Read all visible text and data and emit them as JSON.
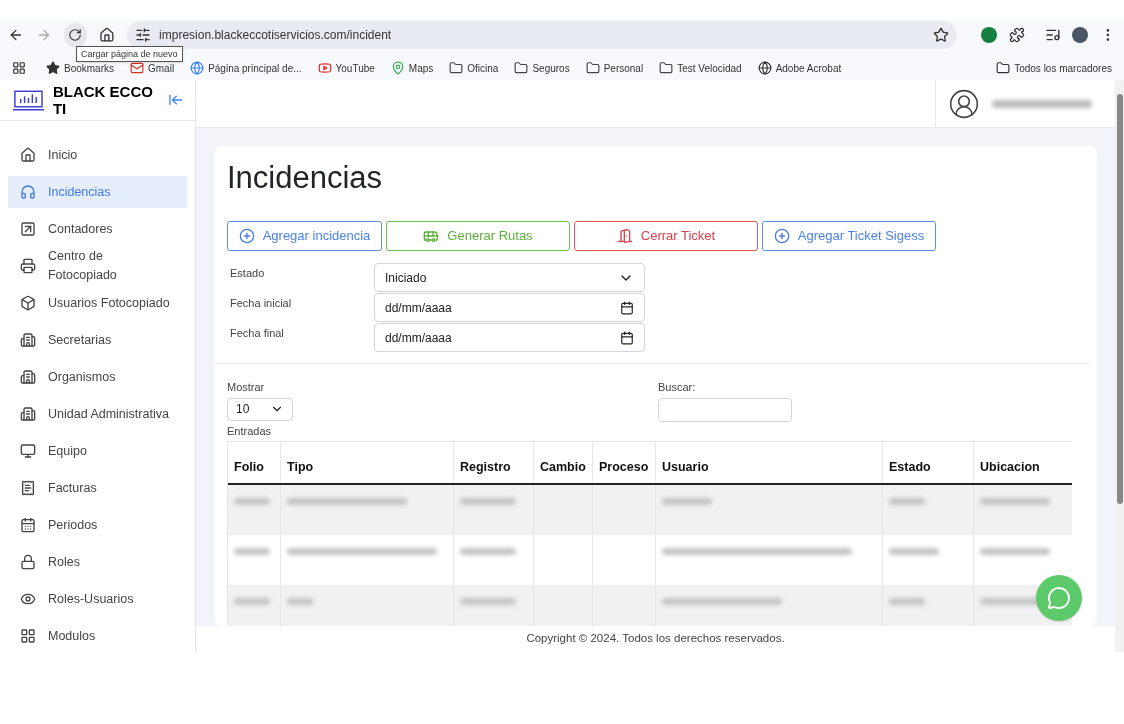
{
  "browser": {
    "url": "impresion.blackeccotiservicios.com/incident",
    "tooltip": "Cargar página de nuevo",
    "bookmarks": [
      {
        "label": "Bookmarks",
        "kind": "star"
      },
      {
        "label": "Gmail",
        "kind": "gmail"
      },
      {
        "label": "Página principal de...",
        "kind": "edge"
      },
      {
        "label": "YouTube",
        "kind": "youtube"
      },
      {
        "label": "Maps",
        "kind": "maps"
      },
      {
        "label": "Oficina",
        "kind": "folder"
      },
      {
        "label": "Seguros",
        "kind": "folder"
      },
      {
        "label": "Personal",
        "kind": "folder"
      },
      {
        "label": "Test Velocidad",
        "kind": "folder"
      },
      {
        "label": "Adobe Acrobat",
        "kind": "globe"
      }
    ],
    "all_bookmarks": "Todos los marcadores"
  },
  "sidebar": {
    "brand": [
      "BLACK ECCO",
      "TI"
    ],
    "items": [
      {
        "label": "Inicio",
        "selected": false
      },
      {
        "label": "Incidencias",
        "selected": true
      },
      {
        "label": "Contadores",
        "selected": false
      },
      {
        "label": "Centro de Fotocopiado",
        "selected": false
      },
      {
        "label": "Usuarios Fotocopiado",
        "selected": false
      },
      {
        "label": "Secretarias",
        "selected": false
      },
      {
        "label": "Organismos",
        "selected": false
      },
      {
        "label": "Unidad Administrativa",
        "selected": false
      },
      {
        "label": "Equipo",
        "selected": false
      },
      {
        "label": "Facturas",
        "selected": false
      },
      {
        "label": "Periodos",
        "selected": false
      },
      {
        "label": "Roles",
        "selected": false
      },
      {
        "label": "Roles-Usuarios",
        "selected": false
      },
      {
        "label": "Modulos",
        "selected": false
      }
    ]
  },
  "page": {
    "title": "Incidencias",
    "buttons": [
      {
        "label": "Agregar incidencia",
        "kind": "add"
      },
      {
        "label": "Generar Rutas",
        "kind": "route"
      },
      {
        "label": "Cerrar Ticket",
        "kind": "close"
      },
      {
        "label": "Agregar Ticket Sigess",
        "kind": "add"
      }
    ],
    "filters": [
      {
        "label": "Estado",
        "kind": "select",
        "value": "Iniciado"
      },
      {
        "label": "Fecha inicial",
        "kind": "date",
        "placeholder": "dd/mm/aaaa"
      },
      {
        "label": "Fecha final",
        "kind": "date",
        "placeholder": "dd/mm/aaaa"
      }
    ]
  },
  "table": {
    "show_label": "Mostrar",
    "page_size": "10",
    "entries_label": "Entradas",
    "search_label": "Buscar:",
    "columns": [
      "Folio",
      "Tipo",
      "Registro",
      "Cambio",
      "Proceso",
      "Usuario",
      "Estado",
      "Ubicacion"
    ],
    "rows": [
      {
        "striped": true
      },
      {
        "striped": false
      },
      {
        "striped": true
      }
    ]
  },
  "footer": "Copyright © 2024. Todos los derechos reservados."
}
